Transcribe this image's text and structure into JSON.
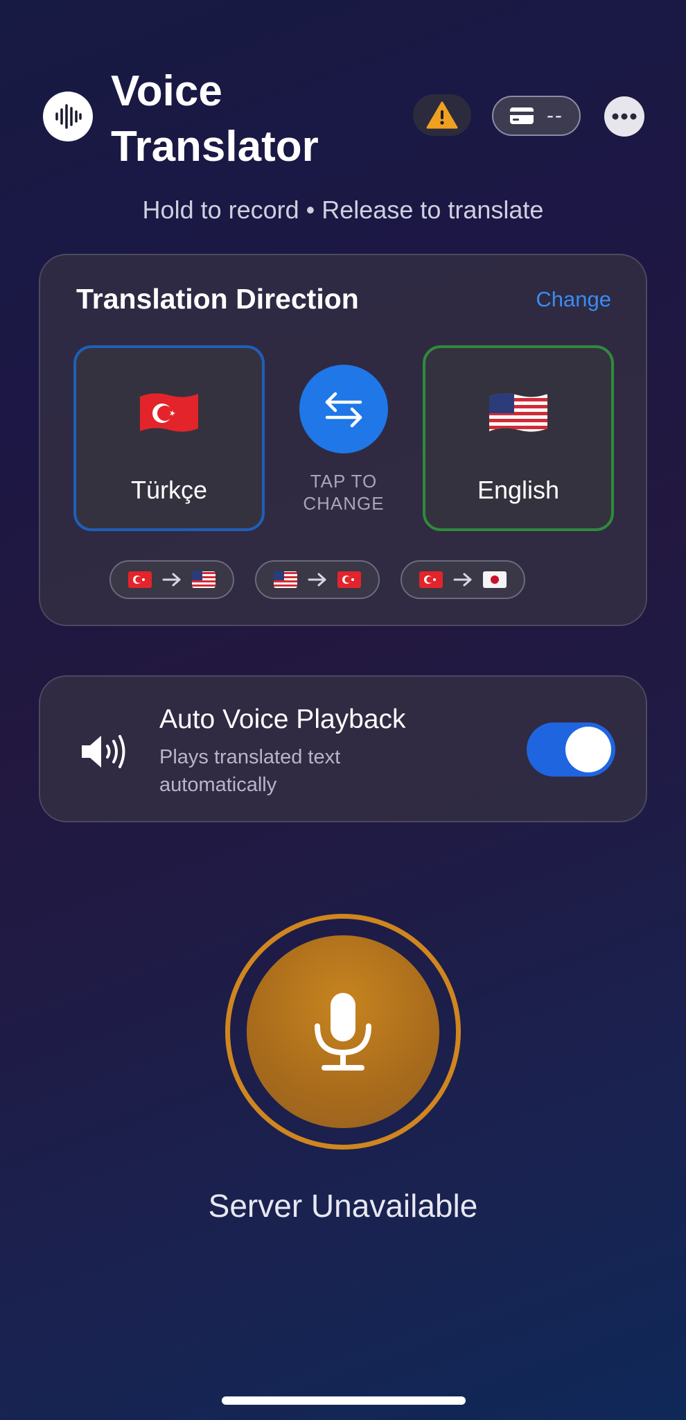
{
  "header": {
    "title": "Voice Translator",
    "logo_icon": "waveform-icon",
    "warning_icon": "warning-icon",
    "credits_icon": "credit-card-icon",
    "credits_value": "--",
    "more_icon": "ellipsis-icon"
  },
  "subtitle": "Hold to record • Release to translate",
  "direction": {
    "title": "Translation Direction",
    "change_label": "Change",
    "source": {
      "flag": "🇹🇷",
      "name": "Türkçe"
    },
    "target": {
      "flag": "🇺🇸",
      "name": "English"
    },
    "swap_label": "TAP TO CHANGE",
    "swap_icon": "swap-arrows-icon",
    "presets": [
      {
        "from": "🇹🇷",
        "to": "🇺🇸"
      },
      {
        "from": "🇺🇸",
        "to": "🇹🇷"
      },
      {
        "from": "🇹🇷",
        "to": "🇯🇵"
      }
    ]
  },
  "playback": {
    "title": "Auto Voice Playback",
    "description": "Plays translated text automatically",
    "enabled": true
  },
  "record": {
    "mic_icon": "microphone-icon",
    "status": "Server Unavailable"
  },
  "colors": {
    "accent_blue": "#1f77e8",
    "link_blue": "#3a8cf2",
    "source_border": "#1e5fb8",
    "target_border": "#2f8a3c",
    "mic_orange": "#d0861f",
    "warning": "#f0a020"
  }
}
